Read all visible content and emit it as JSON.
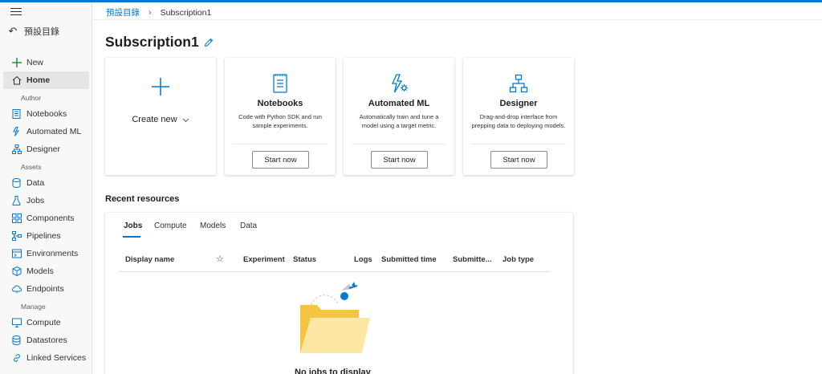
{
  "breadcrumb": {
    "parent": "預設目錄",
    "current": "Subscription1"
  },
  "sidebar": {
    "back_label": "預設目錄",
    "new_label": "New",
    "home_label": "Home",
    "sections": {
      "author": "Author",
      "assets": "Assets",
      "manage": "Manage"
    },
    "author_items": [
      "Notebooks",
      "Automated ML",
      "Designer"
    ],
    "asset_items": [
      "Data",
      "Jobs",
      "Components",
      "Pipelines",
      "Environments",
      "Models",
      "Endpoints"
    ],
    "manage_items": [
      "Compute",
      "Datastores",
      "Linked Services"
    ]
  },
  "page": {
    "title": "Subscription1"
  },
  "cards": {
    "create_new": "Create new",
    "notebooks": {
      "title": "Notebooks",
      "desc": "Code with Python SDK and run sample experiments.",
      "button": "Start now"
    },
    "automl": {
      "title": "Automated ML",
      "desc": "Automatically train and tune a model using a target metric.",
      "button": "Start now"
    },
    "designer": {
      "title": "Designer",
      "desc": "Drag-and-drop interface from prepping data to deploying models.",
      "button": "Start now"
    }
  },
  "recent": {
    "title": "Recent resources",
    "tabs": [
      "Jobs",
      "Compute",
      "Models",
      "Data"
    ],
    "columns": [
      "Display name",
      "☆",
      "Experiment",
      "Status",
      "Logs",
      "Submitted time",
      "Submitte...",
      "Job type"
    ],
    "empty_text": "No jobs to display"
  },
  "colors": {
    "accent": "#0078d4",
    "sidebar_bg": "#f8f8f8",
    "folder": "#f6c443"
  }
}
